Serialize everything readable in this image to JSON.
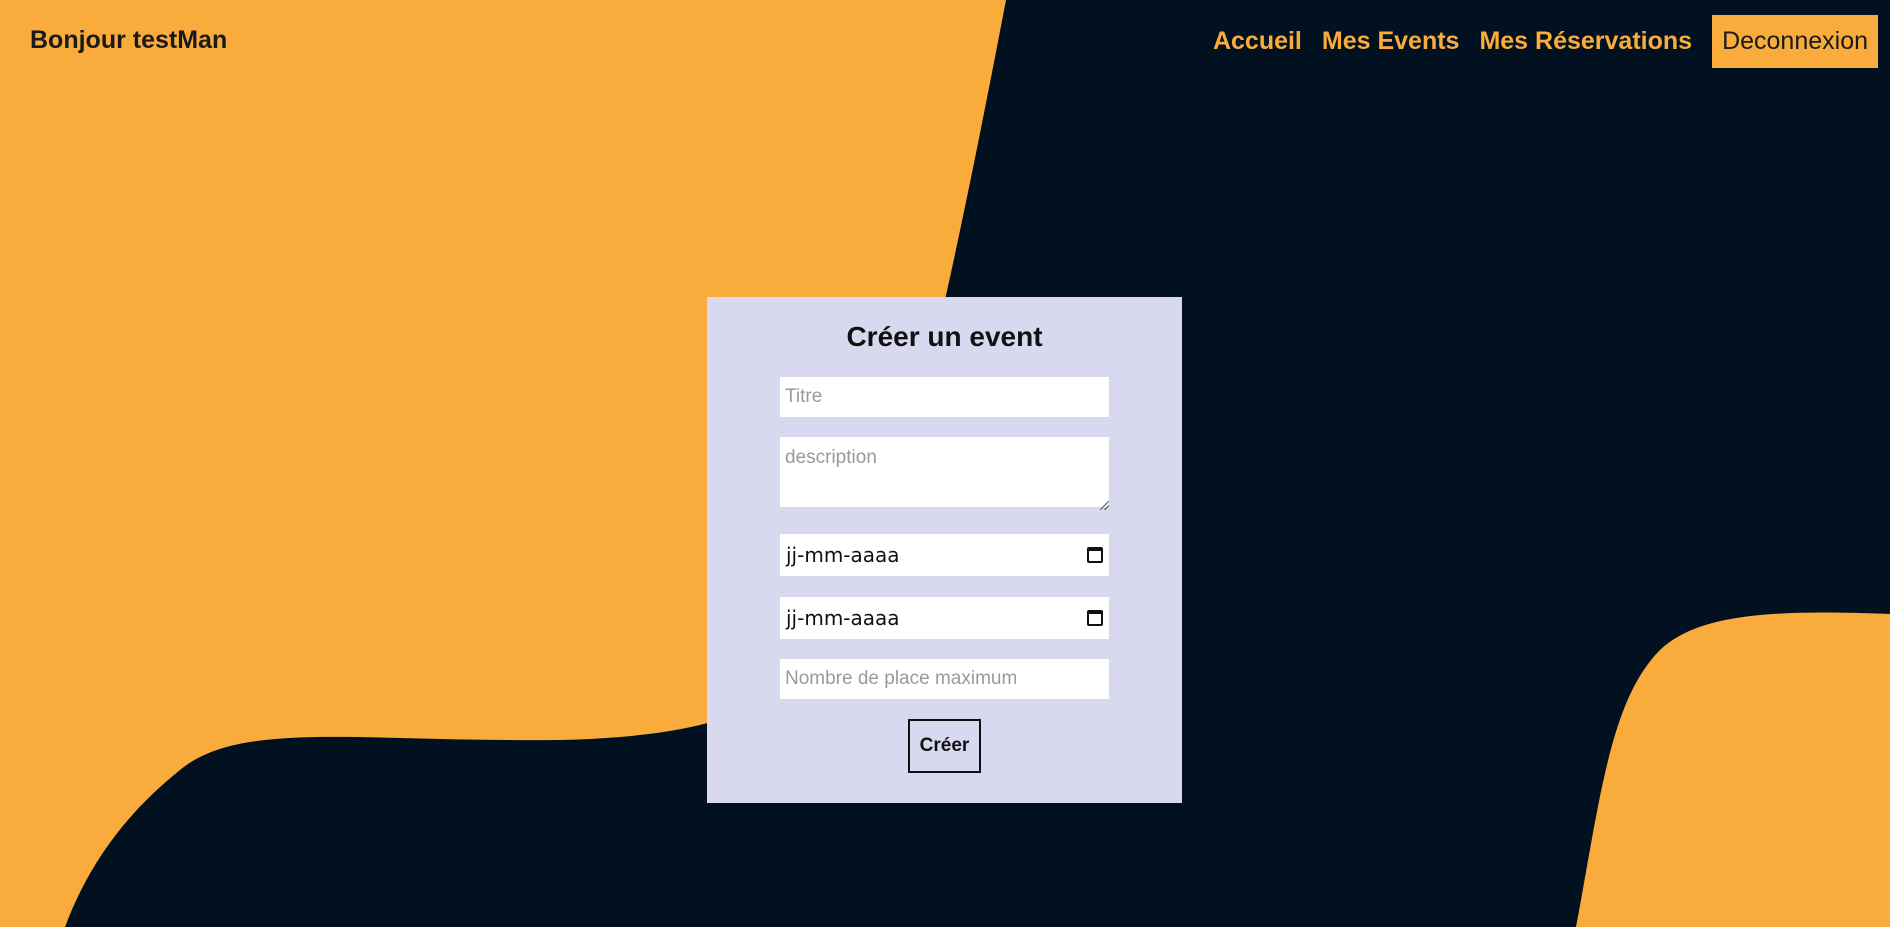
{
  "header": {
    "greeting": "Bonjour testMan",
    "nav": {
      "home_label": "Accueil",
      "events_label": "Mes Events",
      "reservations_label": "Mes Réservations",
      "logout_label": "Deconnexion"
    }
  },
  "form": {
    "title": "Créer un event",
    "title_placeholder": "Titre",
    "description_placeholder": "description",
    "start_date_placeholder": "jj-mm-aaaa",
    "end_date_placeholder": "jj-mm-aaaa",
    "max_places_placeholder": "Nombre de place maximum",
    "submit_label": "Créer"
  },
  "colors": {
    "accent": "#f9ac3c",
    "background": "#01111f",
    "card": "#d8d8ef"
  },
  "icons": {
    "date_picker": "calendar-icon"
  }
}
